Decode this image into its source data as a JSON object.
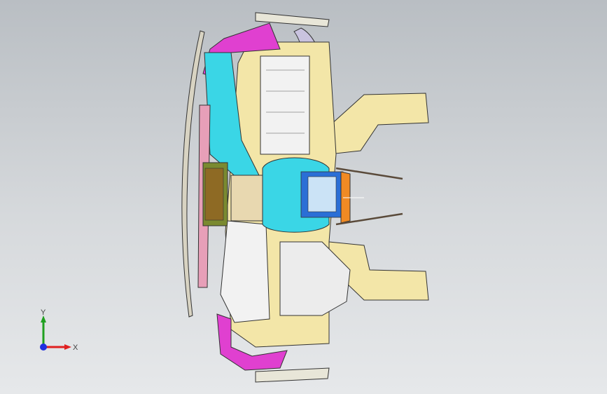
{
  "viewport": {
    "background_top": "#b9bec3",
    "background_bottom": "#e6e8ea"
  },
  "triad": {
    "x_label": "X",
    "y_label": "Y",
    "x_color": "#e02020",
    "y_color": "#20a020",
    "z_color": "#2030e0"
  },
  "model": {
    "part_colors": {
      "magenta": "#e040d0",
      "cyan": "#3ad6e6",
      "yellow": "#f3e6a8",
      "lavender": "#c9c3df",
      "orange": "#f08a24",
      "olive": "#7a8a30",
      "pink": "#e79fb8",
      "white": "#f2f2f2",
      "blue": "#2a6fd6"
    }
  }
}
